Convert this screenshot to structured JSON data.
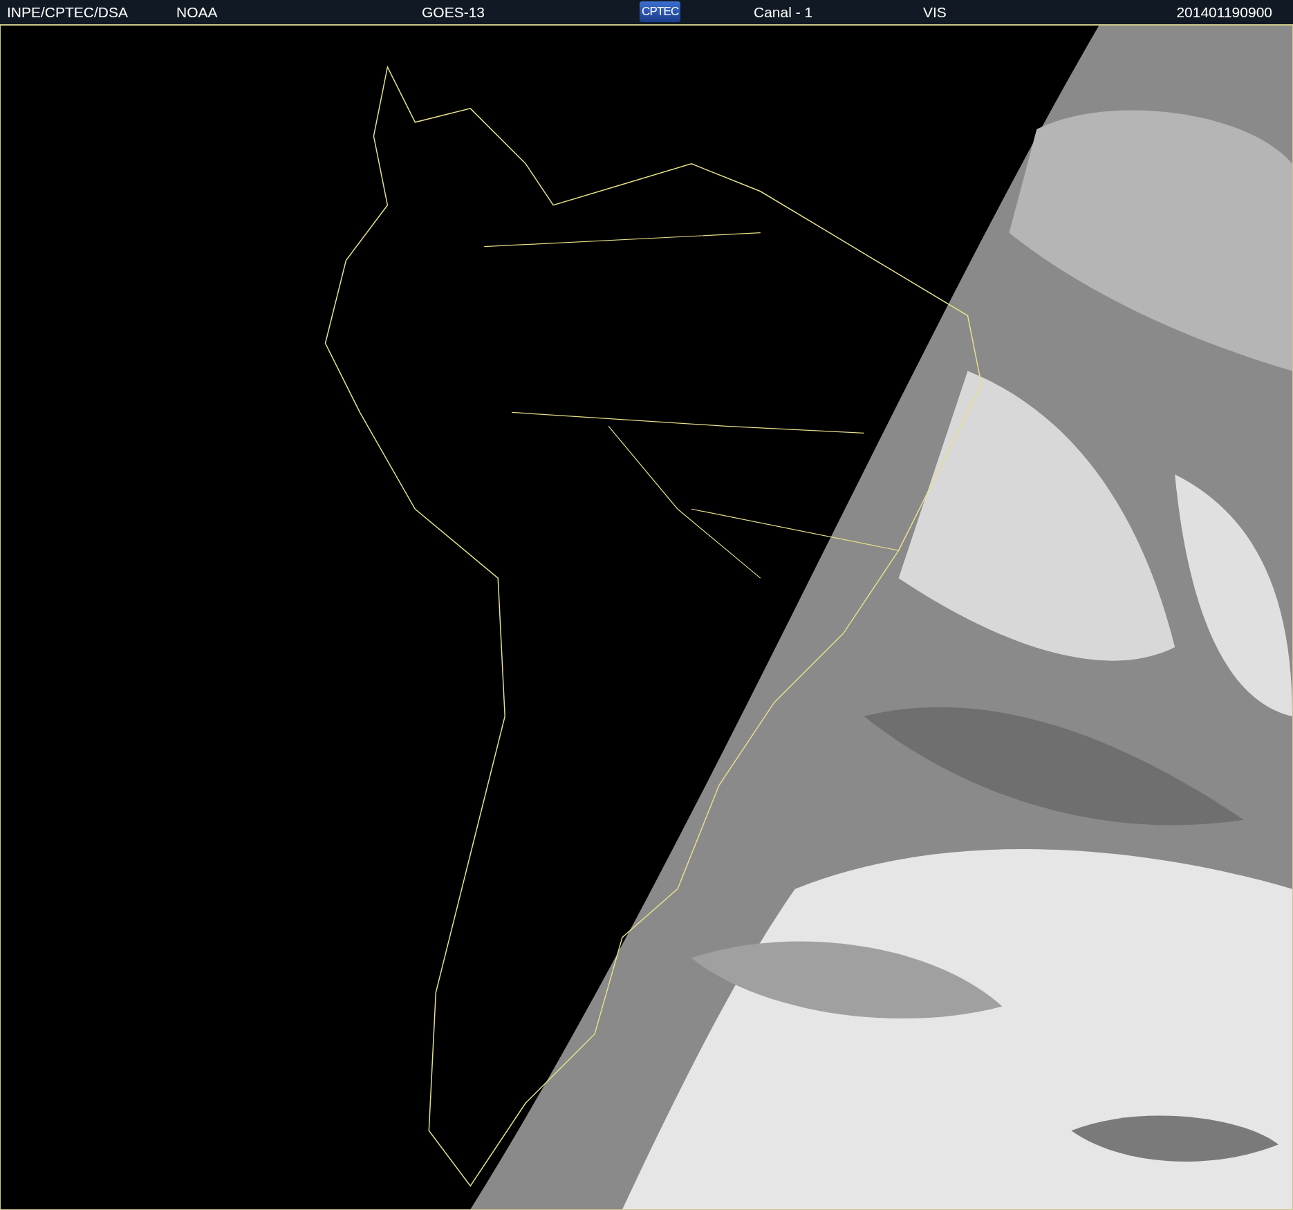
{
  "header": {
    "items": [
      {
        "kind": "text",
        "text": "INPE/CPTEC/DSA"
      },
      {
        "kind": "text",
        "text": "NOAA"
      },
      {
        "kind": "text",
        "text": "GOES-13"
      },
      {
        "kind": "logo",
        "text": "CPTEC"
      },
      {
        "kind": "text",
        "text": "Canal - 1"
      },
      {
        "kind": "text",
        "text": "VIS"
      },
      {
        "kind": "text",
        "text": "201401190900"
      }
    ]
  }
}
